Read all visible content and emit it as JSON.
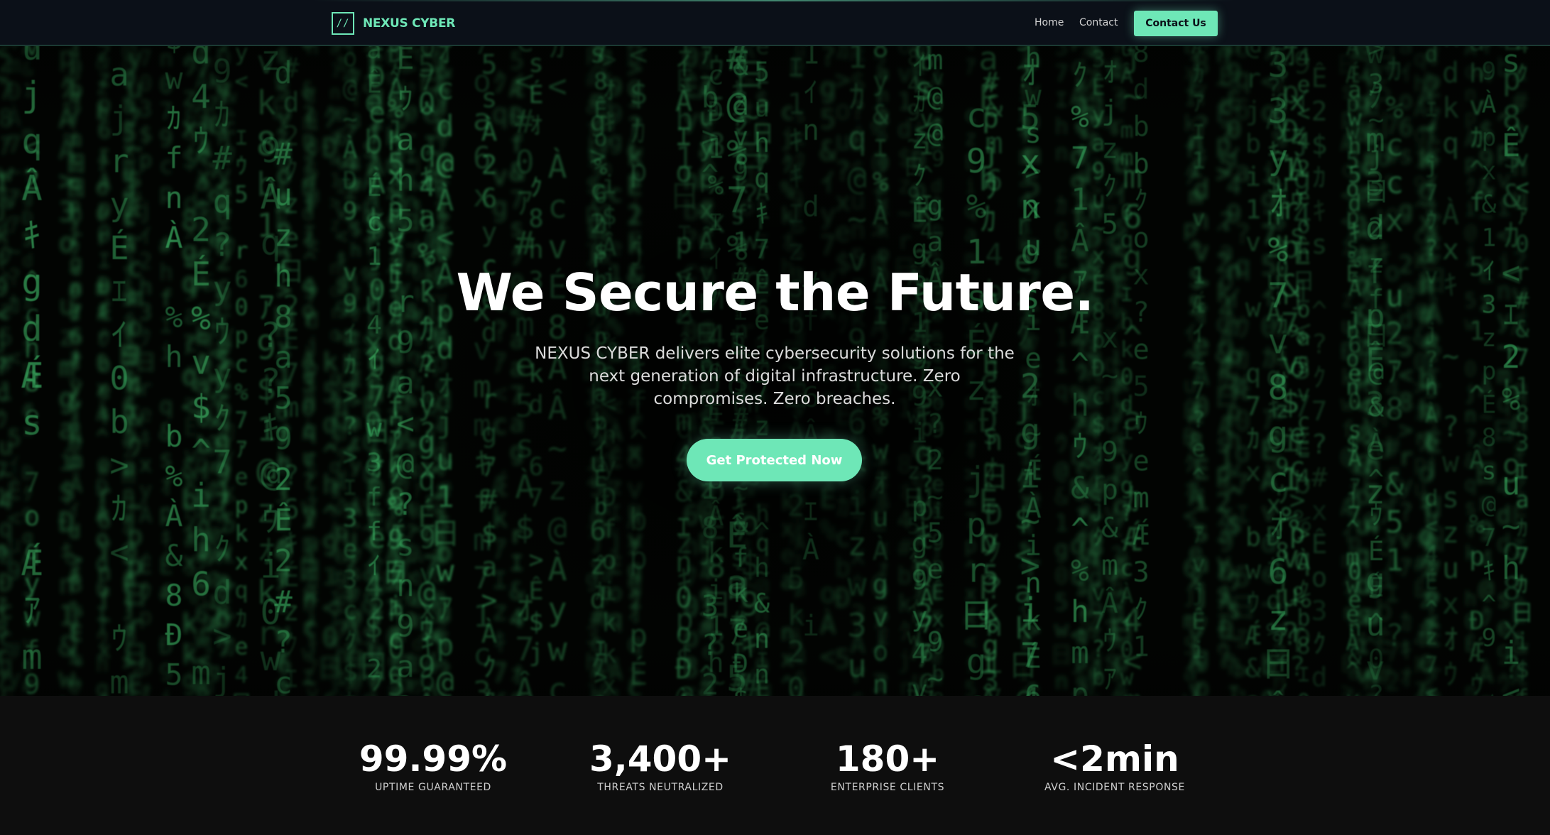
{
  "nav": {
    "logo_mark": "//",
    "brand": "NEXUS CYBER",
    "links": [
      {
        "label": "Home"
      },
      {
        "label": "Contact"
      }
    ],
    "cta_label": "Contact Us"
  },
  "hero": {
    "background": "matrix-code-rain-image",
    "title": "We Secure the Future.",
    "subtitle": "NEXUS CYBER delivers elite cybersecurity solutions for the next generation of digital infrastructure. Zero compromises. Zero breaches.",
    "cta_label": "Get Protected Now"
  },
  "stats": [
    {
      "value": "99.99%",
      "label": "UPTIME GUARANTEED"
    },
    {
      "value": "3,400+",
      "label": "THREATS NEUTRALIZED"
    },
    {
      "value": "180+",
      "label": "ENTERPRISE CLIENTS"
    },
    {
      "value": "<2min",
      "label": "AVG. INCIDENT RESPONSE"
    }
  ],
  "colors": {
    "accent": "#6ee7b7",
    "nav_bg": "#0b1018",
    "page_bg": "#0e0e0e",
    "matrix_green": "#3fbf6a"
  }
}
